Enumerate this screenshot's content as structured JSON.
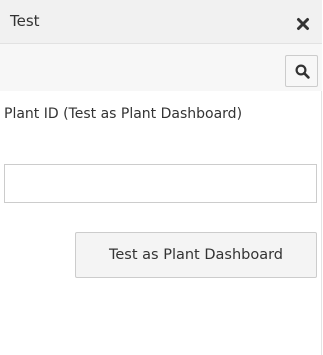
{
  "panel": {
    "title": "Test",
    "close_icon": "close-x-icon"
  },
  "toolbar": {
    "search_icon": "magnifier-search-icon"
  },
  "form": {
    "plant_id_label": "Plant ID (Test as Plant Dashboard)",
    "plant_id_value": "",
    "plant_id_placeholder": "",
    "submit_label": "Test as Plant Dashboard"
  }
}
